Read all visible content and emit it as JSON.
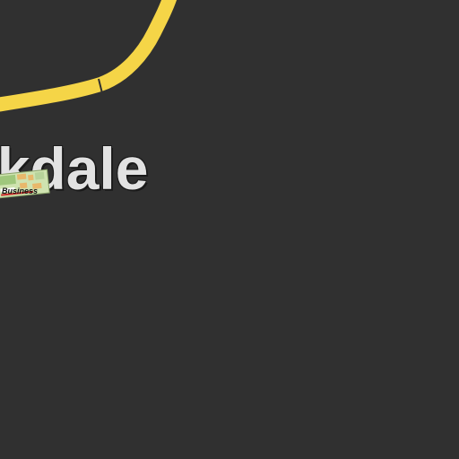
{
  "map": {
    "background_color": "#303030",
    "road_color": "#f5d547",
    "label_color": "#e2e2e2",
    "place_label": "akdale",
    "poi": {
      "icon": "business-thumbnail-icon",
      "label": "Business"
    }
  }
}
